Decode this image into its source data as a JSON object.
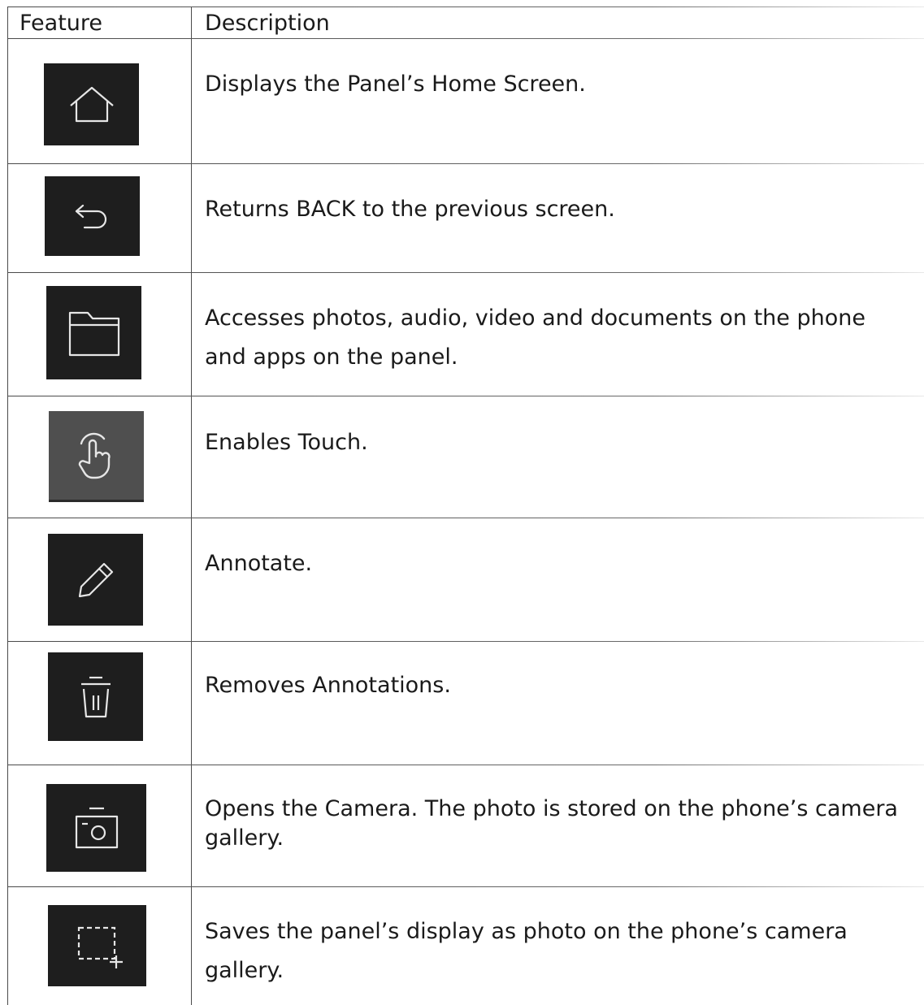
{
  "headers": {
    "feature": "Feature",
    "description": "Description"
  },
  "rows": [
    {
      "icon": "home-icon",
      "description": "Displays the Panel’s Home Screen."
    },
    {
      "icon": "back-arrow-icon",
      "description": "Returns BACK to the previous screen."
    },
    {
      "icon": "folder-icon",
      "description": "Accesses photos, audio, video and documents on the phone and apps on the panel."
    },
    {
      "icon": "touch-hand-icon",
      "description": "Enables Touch."
    },
    {
      "icon": "pencil-icon",
      "description": "Annotate."
    },
    {
      "icon": "trash-icon",
      "description": "Removes Annotations."
    },
    {
      "icon": "camera-icon",
      "description": "Opens the Camera. The photo is stored on the phone’s camera gallery."
    },
    {
      "icon": "screenshot-icon",
      "description": "Saves the panel’s display as photo on the phone’s camera gallery."
    }
  ],
  "colors": {
    "icon_background": "#1e1e1e",
    "touch_icon_background": "#4f4f4f",
    "icon_stroke": "#e6e6e6",
    "border": "#4a4a4a"
  }
}
